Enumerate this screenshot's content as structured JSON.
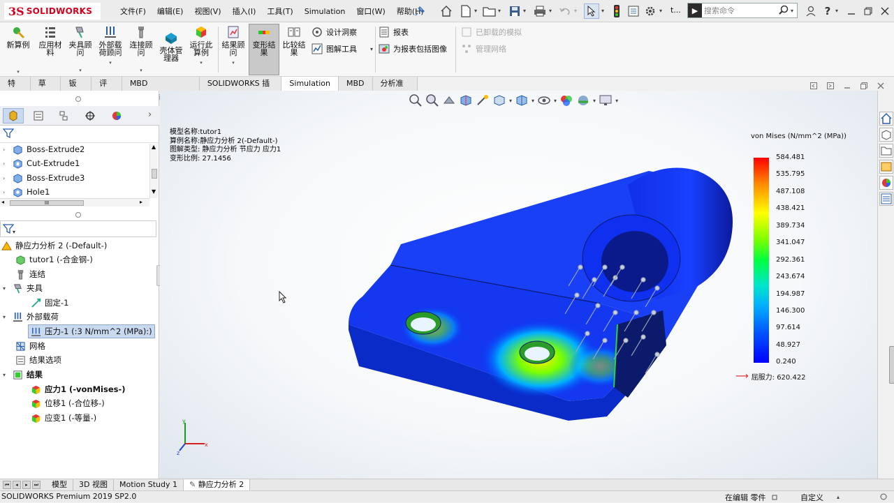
{
  "app": {
    "brand_ds": "3S",
    "brand": "SOLIDWORKS"
  },
  "menu": [
    "文件(F)",
    "编辑(E)",
    "视图(V)",
    "插入(I)",
    "工具(T)",
    "Simulation",
    "窗口(W)",
    "帮助(H)"
  ],
  "titlebar": {
    "doc_abbrev": "t...",
    "search_placeholder": "搜索命令"
  },
  "commands": {
    "new_study": "新算例",
    "apply_material": "应用材料",
    "fixtures_advisor": "夹具顾问",
    "external_loads_advisor": "外部载荷顾问",
    "connections_advisor": "连接顾问",
    "shell_manager": "壳体管理器",
    "run_study": "运行此算例",
    "results_advisor": "结果顾问",
    "deformed_result": "变形结果",
    "compare_results": "比较结果",
    "design_insight": "设计洞察",
    "plot_tools": "图解工具",
    "report": "报表",
    "include_image": "为报表包括图像",
    "unloaded_sims": "已卸载的模拟",
    "manage_network": "管理网络"
  },
  "tabs": [
    "特征",
    "草图",
    "钣金",
    "评估",
    "MBD Dimensions",
    "SOLIDWORKS 插件",
    "Simulation",
    "MBD",
    "分析准备"
  ],
  "active_tab": "Simulation",
  "feature_tree": [
    "Boss-Extrude2",
    "Cut-Extrude1",
    "Boss-Extrude3",
    "Hole1"
  ],
  "scroll_mid": "III",
  "sim_tree": {
    "study": "静应力分析 2 (-Default-)",
    "part": "tutor1 (-合金钢-)",
    "connections": "连结",
    "fixtures": "夹具",
    "fixed": "固定-1",
    "external_loads": "外部载荷",
    "pressure": "压力-1 (:3 N/mm^2 (MPa):)",
    "mesh": "网格",
    "result_options": "结果选项",
    "results": "结果",
    "stress": "应力1 (-vonMises-)",
    "displacement": "位移1 (-合位移-)",
    "strain": "应变1 (-等量-)"
  },
  "plot_info": {
    "model_name": "模型名称:tutor1",
    "study_name": "算例名称:静应力分析 2(-Default-)",
    "plot_type": "图解类型: 静应力分析 节应力 应力1",
    "deformation_scale": "变形比例: 27.1456"
  },
  "legend": {
    "title": "von Mises (N/mm^2 (MPa))",
    "ticks": [
      "584.481",
      "535.795",
      "487.108",
      "438.421",
      "389.734",
      "341.047",
      "292.361",
      "243.674",
      "194.987",
      "146.300",
      "97.614",
      "48.927",
      "0.240"
    ],
    "yield": "屈服力: 620.422",
    "colors": {
      "max": "#ff0000",
      "mid": "#00ff40",
      "min": "#0000ff"
    }
  },
  "triad": {
    "x": "x",
    "y": "y",
    "z": "z"
  },
  "bottom_tabs": [
    "模型",
    "3D 视图",
    "Motion Study 1",
    "静应力分析 2"
  ],
  "active_bottom_tab": "静应力分析 2",
  "status": {
    "left": "SOLIDWORKS Premium 2019 SP2.0",
    "editing": "在编辑 零件",
    "custom": "自定义"
  }
}
